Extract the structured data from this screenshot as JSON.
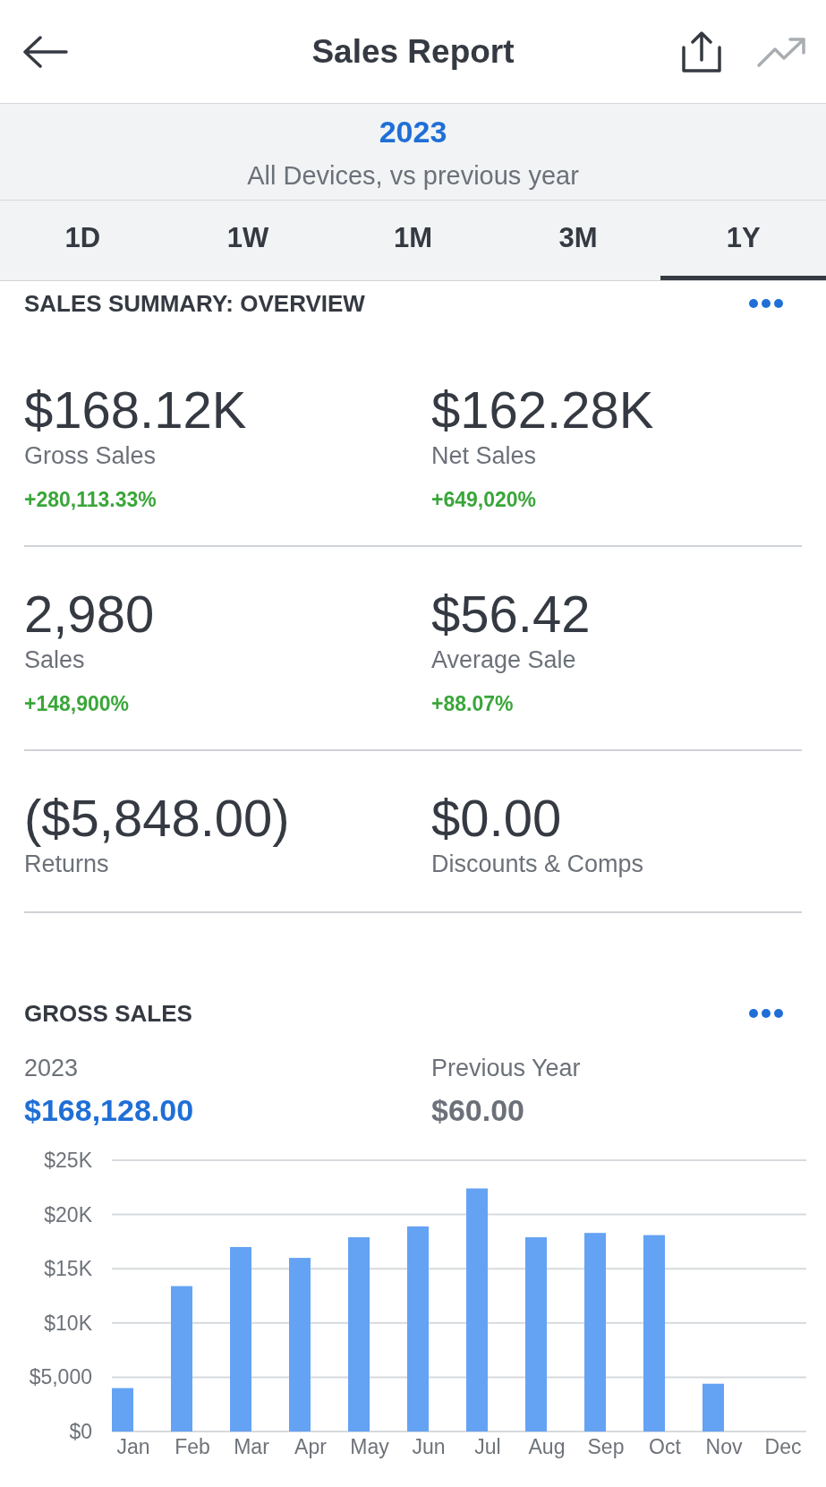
{
  "header": {
    "title": "Sales Report"
  },
  "period": {
    "year": "2023",
    "subtitle": "All Devices, vs previous year"
  },
  "tabs": [
    {
      "label": "1D",
      "selected": false
    },
    {
      "label": "1W",
      "selected": false
    },
    {
      "label": "1M",
      "selected": false
    },
    {
      "label": "3M",
      "selected": false
    },
    {
      "label": "1Y",
      "selected": true
    }
  ],
  "summary": {
    "title": "SALES SUMMARY: OVERVIEW",
    "metrics": [
      {
        "value": "$168.12K",
        "label": "Gross Sales",
        "change": "+280,113.33%"
      },
      {
        "value": "$162.28K",
        "label": "Net Sales",
        "change": "+649,020%"
      },
      {
        "value": "2,980",
        "label": "Sales",
        "change": "+148,900%"
      },
      {
        "value": "$56.42",
        "label": "Average Sale",
        "change": "+88.07%"
      },
      {
        "value": "($5,848.00)",
        "label": "Returns"
      },
      {
        "value": "$0.00",
        "label": "Discounts & Comps"
      }
    ]
  },
  "gross_sales": {
    "title": "GROSS SALES",
    "current": {
      "label": "2023",
      "value": "$168,128.00"
    },
    "previous": {
      "label": "Previous Year",
      "value": "$60.00"
    },
    "chart_data": {
      "type": "bar",
      "grid": true,
      "categories": [
        "Jan",
        "Feb",
        "Mar",
        "Apr",
        "May",
        "Jun",
        "Jul",
        "Aug",
        "Sep",
        "Oct",
        "Nov",
        "Dec"
      ],
      "series": [
        {
          "color": "#64a2f4",
          "values": [
            4000,
            13400,
            17000,
            16000,
            17900,
            18900,
            22400,
            17900,
            18300,
            18100,
            4400,
            0
          ]
        }
      ],
      "ylim": [
        0,
        25000
      ],
      "yticks": [
        {
          "value": 0,
          "label": "$0"
        },
        {
          "value": 5000,
          "label": "$5,000"
        },
        {
          "value": 10000,
          "label": "$10K"
        },
        {
          "value": 15000,
          "label": "$15K"
        },
        {
          "value": 20000,
          "label": "$20K"
        },
        {
          "value": 25000,
          "label": "$25K"
        }
      ]
    }
  }
}
